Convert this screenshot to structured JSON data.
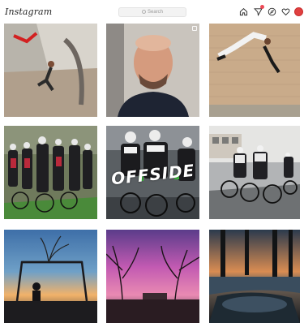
{
  "app": {
    "logo": "Instagram"
  },
  "search": {
    "placeholder": "Search"
  },
  "nav": {
    "icons": [
      "home-icon",
      "direct-icon",
      "explore-icon",
      "heart-icon",
      "profile-avatar"
    ],
    "accent_color": "#ed4956"
  },
  "posts": [
    {
      "caption": "",
      "type": "single",
      "subject": "parkour jump near building"
    },
    {
      "caption": "",
      "type": "carousel",
      "subject": "portrait of bald man"
    },
    {
      "caption": "",
      "type": "single",
      "subject": "backflip against brick wall"
    },
    {
      "caption": "",
      "type": "single",
      "subject": "cycling peloton"
    },
    {
      "caption": "OFFSIDE",
      "type": "single",
      "subject": "cyclists racing"
    },
    {
      "caption": "",
      "type": "single",
      "subject": "cyclists on street"
    },
    {
      "caption": "",
      "type": "single",
      "subject": "playground swing at sunset"
    },
    {
      "caption": "",
      "type": "single",
      "subject": "pink sunset trees"
    },
    {
      "caption": "",
      "type": "single",
      "subject": "flooded park at dusk"
    }
  ]
}
